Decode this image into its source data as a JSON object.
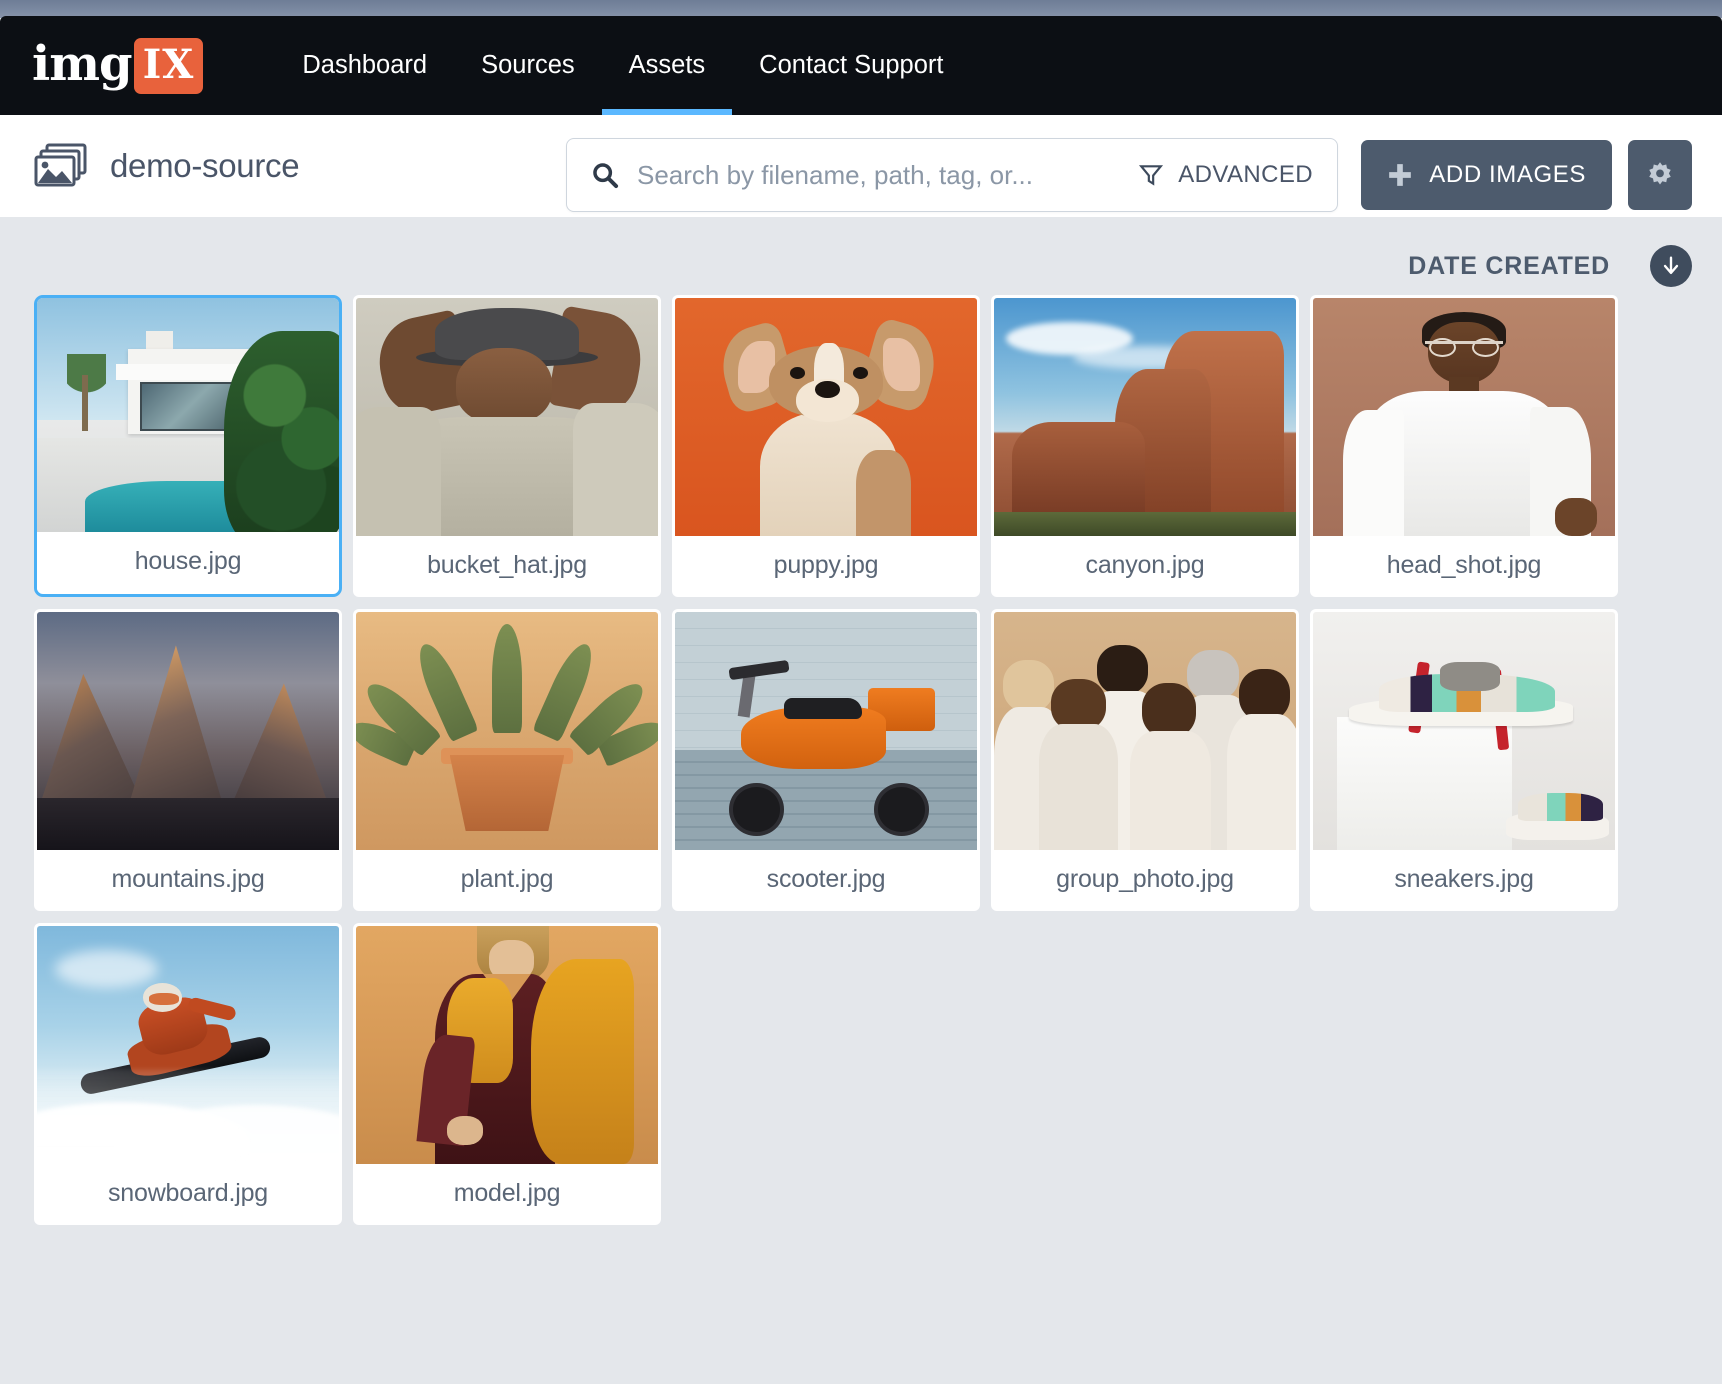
{
  "nav": {
    "logo": {
      "text_primary": "img",
      "text_badge": "IX",
      "badge_color": "#e8623c"
    },
    "links": [
      {
        "label": "Dashboard",
        "active": false
      },
      {
        "label": "Sources",
        "active": false
      },
      {
        "label": "Assets",
        "active": true
      },
      {
        "label": "Contact Support",
        "active": false
      }
    ],
    "active_underline_color": "#5bb8ff",
    "background_color": "#0c0f14"
  },
  "subheader": {
    "source_icon": "stacked-images-icon",
    "source_name": "demo-source",
    "search": {
      "icon": "search-icon",
      "placeholder": "Search by filename, path, tag, or...",
      "value": ""
    },
    "advanced": {
      "icon": "filter-icon",
      "label": "ADVANCED"
    },
    "add_images": {
      "icon": "plus-icon",
      "label": "ADD IMAGES"
    },
    "settings": {
      "icon": "gear-icon"
    },
    "button_color": "#4d5b6d"
  },
  "toolbar": {
    "sort_field": "DATE CREATED",
    "sort_direction_icon": "arrow-down-icon",
    "sort_direction": "descending"
  },
  "grid": {
    "background_color": "#e4e7eb",
    "selected_border_color": "#4ab0f5",
    "assets": [
      {
        "filename": "house.jpg",
        "selected": true,
        "thumb": "t-house"
      },
      {
        "filename": "bucket_hat.jpg",
        "selected": false,
        "thumb": "t-bucket"
      },
      {
        "filename": "puppy.jpg",
        "selected": false,
        "thumb": "t-puppy"
      },
      {
        "filename": "canyon.jpg",
        "selected": false,
        "thumb": "t-canyon"
      },
      {
        "filename": "head_shot.jpg",
        "selected": false,
        "thumb": "t-head"
      },
      {
        "filename": "mountains.jpg",
        "selected": false,
        "thumb": "t-mountains"
      },
      {
        "filename": "plant.jpg",
        "selected": false,
        "thumb": "t-plant"
      },
      {
        "filename": "scooter.jpg",
        "selected": false,
        "thumb": "t-scooter"
      },
      {
        "filename": "group_photo.jpg",
        "selected": false,
        "thumb": "t-group"
      },
      {
        "filename": "sneakers.jpg",
        "selected": false,
        "thumb": "t-sneakers"
      },
      {
        "filename": "snowboard.jpg",
        "selected": false,
        "thumb": "t-snowboard"
      },
      {
        "filename": "model.jpg",
        "selected": false,
        "thumb": "t-model"
      }
    ]
  }
}
